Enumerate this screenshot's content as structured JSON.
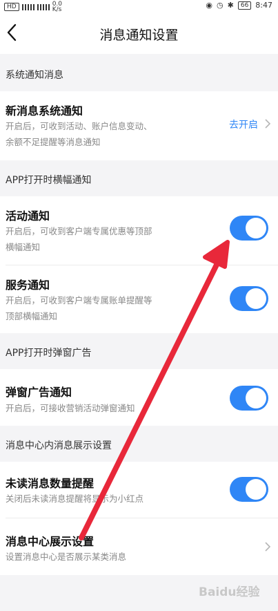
{
  "status_bar": {
    "network": "HD",
    "speed_value": "0.0",
    "speed_unit": "K/s",
    "battery": "66",
    "time": "8:47"
  },
  "header": {
    "title": "消息通知设置"
  },
  "sections": [
    {
      "header": "系统通知消息",
      "items": [
        {
          "title": "新消息系统通知",
          "desc_line1": "开启后，可收到活动、账户信息变动、",
          "desc_line2": "余额不足提醒等消息通知",
          "action_label": "去开启"
        }
      ]
    },
    {
      "header": "APP打开时横幅通知",
      "items": [
        {
          "title": "活动通知",
          "desc_line1": "开启后，可收到客户端专属优惠等顶部",
          "desc_line2": "横幅通知",
          "toggle_on": true
        },
        {
          "title": "服务通知",
          "desc_line1": "开启后，可收到客户端专属账单提醒等",
          "desc_line2": "顶部横幅通知",
          "toggle_on": true
        }
      ]
    },
    {
      "header": "APP打开时弹窗广告",
      "items": [
        {
          "title": "弹窗广告通知",
          "desc_line1": "开启后，可接收营销活动弹窗通知",
          "toggle_on": true
        }
      ]
    },
    {
      "header": "消息中心内消息展示设置",
      "items": [
        {
          "title": "未读消息数量提醒",
          "desc_line1": "关闭后未读消息提醒将显示为小红点",
          "toggle_on": true
        },
        {
          "title": "消息中心展示设置",
          "desc_line1": "设置消息中心是否展示某类消息"
        }
      ]
    }
  ],
  "watermark": "Baidu经验",
  "colors": {
    "accent": "#2f86f6",
    "arrow": "#e8283a",
    "background": "#f4f4f6"
  }
}
